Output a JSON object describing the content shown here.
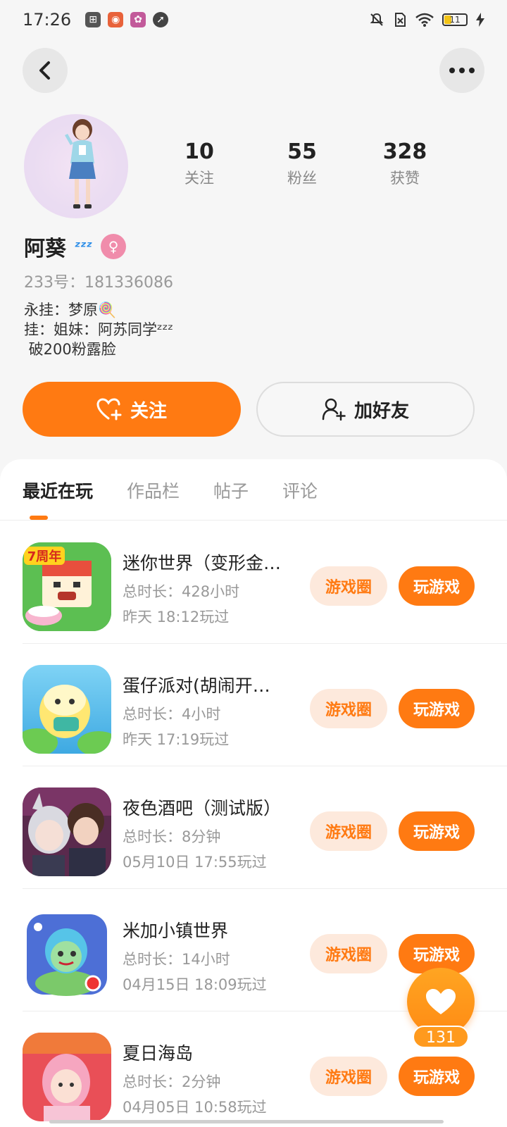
{
  "status_bar": {
    "time": "17:26",
    "battery": "11"
  },
  "profile": {
    "stats": [
      {
        "value": "10",
        "label": "关注"
      },
      {
        "value": "55",
        "label": "粉丝"
      },
      {
        "value": "328",
        "label": "获赞"
      }
    ],
    "name": "阿葵",
    "name_suffix": "ᶻᶻᶻ",
    "gender_symbol": "♀",
    "uid": "233号：181336086",
    "bio": [
      "永挂：梦原🍭",
      "挂：姐妹：阿苏同学ᶻᶻᶻ",
      " 破200粉露脸"
    ]
  },
  "actions": {
    "follow_label": "关注",
    "add_friend_label": "加好友"
  },
  "tabs": [
    {
      "label": "最近在玩",
      "active": true
    },
    {
      "label": "作品栏",
      "active": false
    },
    {
      "label": "帖子",
      "active": false
    },
    {
      "label": "评论",
      "active": false
    }
  ],
  "games": [
    {
      "title": "迷你世界（变形金…",
      "duration": "总时长：428小时",
      "last_played": "昨天 18:12玩过",
      "circle_label": "游戏圈",
      "play_label": "玩游戏",
      "icon": "mini-world-icon",
      "badge": "7周年"
    },
    {
      "title": "蛋仔派对(胡闹开…",
      "duration": "总时长：4小时",
      "last_played": "昨天 17:19玩过",
      "circle_label": "游戏圈",
      "play_label": "玩游戏",
      "icon": "eggy-party-icon"
    },
    {
      "title": "夜色酒吧（测试版）",
      "duration": "总时长：8分钟",
      "last_played": "05月10日 17:55玩过",
      "circle_label": "游戏圈",
      "play_label": "玩游戏",
      "icon": "night-bar-icon"
    },
    {
      "title": "米加小镇世界",
      "duration": "总时长：14小时",
      "last_played": "04月15日 18:09玩过",
      "circle_label": "游戏圈",
      "play_label": "玩游戏",
      "icon": "miga-town-icon"
    },
    {
      "title": "夏日海岛",
      "duration": "总时长：2分钟",
      "last_played": "04月05日 10:58玩过",
      "circle_label": "游戏圈",
      "play_label": "玩游戏",
      "icon": "summer-island-icon"
    }
  ],
  "floating_like": {
    "count": "131"
  },
  "colors": {
    "accent": "#ff7a12",
    "accent_soft": "#fde9dc",
    "background": "#f6f6f6"
  }
}
